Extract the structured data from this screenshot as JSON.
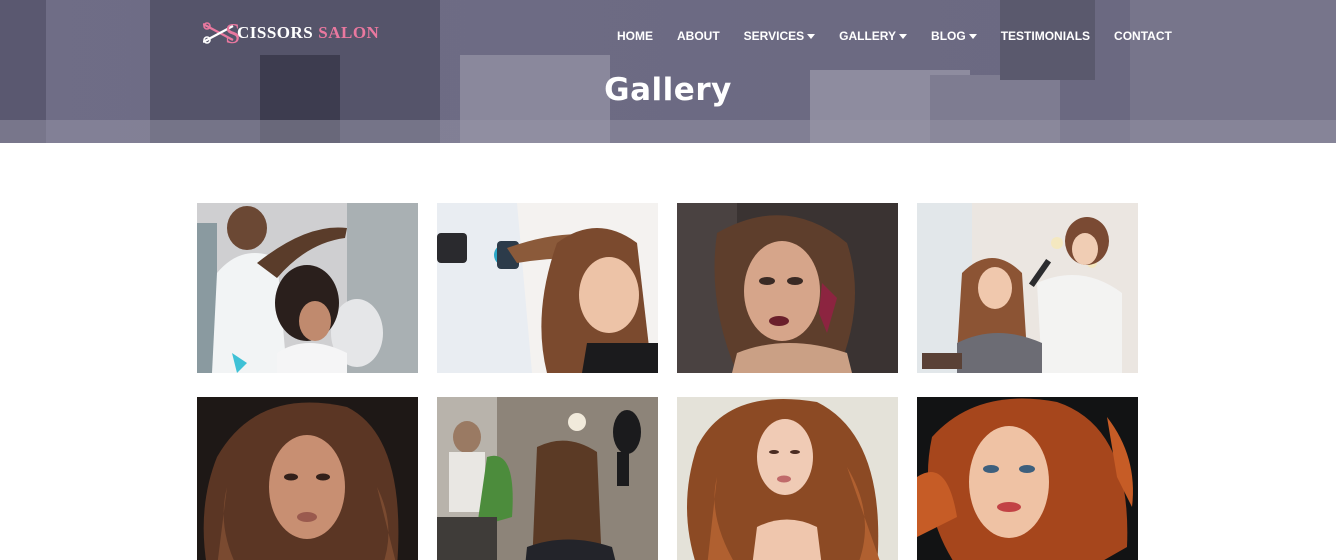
{
  "brand": {
    "name_part1": "CISSORS",
    "name_part2": "SALON",
    "logo_letter": "S",
    "accent_color": "#e9789f"
  },
  "nav": {
    "items": [
      {
        "label": "HOME",
        "dropdown": false
      },
      {
        "label": "ABOUT",
        "dropdown": false
      },
      {
        "label": "SERVICES",
        "dropdown": true
      },
      {
        "label": "GALLERY",
        "dropdown": true
      },
      {
        "label": "BLOG",
        "dropdown": true
      },
      {
        "label": "TESTIMONIALS",
        "dropdown": false
      },
      {
        "label": "CONTACT",
        "dropdown": false
      }
    ]
  },
  "page": {
    "title": "Gallery"
  },
  "gallery": {
    "images": [
      {
        "subject": "stylist-cutting-hair-photo"
      },
      {
        "subject": "blow-dry-brush-photo"
      },
      {
        "subject": "makeup-portrait-photo"
      },
      {
        "subject": "stylist-curling-hair-photo"
      },
      {
        "subject": "curly-brunette-portrait-photo"
      },
      {
        "subject": "hair-dryer-styling-photo"
      },
      {
        "subject": "curly-red-hair-portrait-photo"
      },
      {
        "subject": "red-hair-portrait-photo"
      }
    ]
  }
}
